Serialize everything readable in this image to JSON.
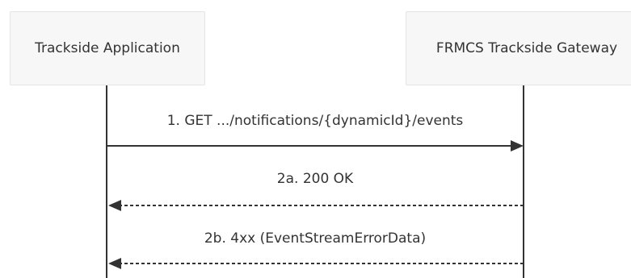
{
  "participants": {
    "left": "Trackside Application",
    "right": "FRMCS Trackside Gateway"
  },
  "messages": [
    {
      "label": "1. GET .../notifications/{dynamicId}/events",
      "direction": "right",
      "style": "solid"
    },
    {
      "label": "2a. 200 OK",
      "direction": "left",
      "style": "dashed"
    },
    {
      "label": "2b. 4xx (EventStreamErrorData)",
      "direction": "left",
      "style": "dashed"
    }
  ],
  "colors": {
    "line": "#333333",
    "participant_fill": "#f7f7f7",
    "participant_border": "#e4e4e4"
  }
}
